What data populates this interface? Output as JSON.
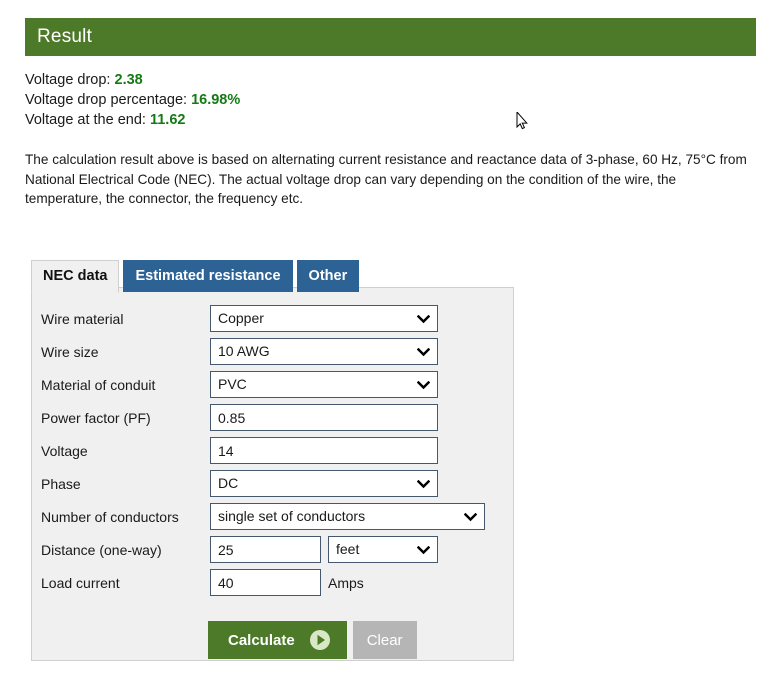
{
  "result": {
    "header_title": "Result",
    "lines": [
      {
        "label": "Voltage drop: ",
        "value": "2.38"
      },
      {
        "label": "Voltage drop percentage: ",
        "value": "16.98%"
      },
      {
        "label": "Voltage at the end: ",
        "value": "11.62"
      }
    ],
    "note": "The calculation result above is based on alternating current resistance and reactance data of 3-phase, 60 Hz, 75°C from National Electrical Code (NEC). The actual voltage drop can vary depending on the condition of the wire, the temperature, the connector, the frequency etc."
  },
  "tabs": [
    {
      "label": "NEC data",
      "active": true
    },
    {
      "label": "Estimated resistance",
      "active": false
    },
    {
      "label": "Other",
      "active": false
    }
  ],
  "form": {
    "wire_material": {
      "label": "Wire material",
      "value": "Copper"
    },
    "wire_size": {
      "label": "Wire size",
      "value": "10 AWG"
    },
    "material_of_conduit": {
      "label": "Material of conduit",
      "value": "PVC"
    },
    "power_factor": {
      "label": "Power factor (PF)",
      "value": "0.85"
    },
    "voltage": {
      "label": "Voltage",
      "value": "14"
    },
    "phase": {
      "label": "Phase",
      "value": "DC"
    },
    "number_of_conductors": {
      "label": "Number of conductors",
      "value": "single set of conductors"
    },
    "distance": {
      "label": "Distance (one-way)",
      "value": "25",
      "unit": "feet"
    },
    "load_current": {
      "label": "Load current",
      "value": "40",
      "unit": "Amps"
    }
  },
  "buttons": {
    "calculate": "Calculate",
    "clear": "Clear"
  },
  "colors": {
    "header_green": "#4c7a28",
    "value_green": "#157a15",
    "tab_blue": "#2d6295",
    "panel_gray": "#f0f0f0",
    "clear_gray": "#b5b5b5"
  }
}
